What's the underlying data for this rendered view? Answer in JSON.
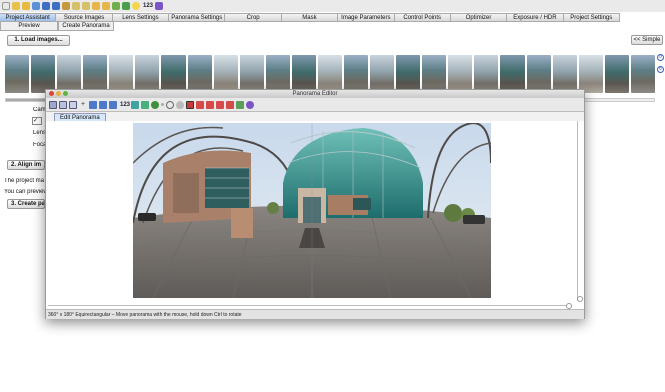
{
  "main": {
    "toolbar": {
      "num_label": "123"
    },
    "tabs": [
      {
        "label": "Project Assistant",
        "active": true
      },
      {
        "label": "Source Images"
      },
      {
        "label": "Lens Settings"
      },
      {
        "label": "Panorama Settings"
      },
      {
        "label": "Crop"
      },
      {
        "label": "Mask"
      },
      {
        "label": "Image Parameters"
      },
      {
        "label": "Control Points"
      },
      {
        "label": "Optimizer"
      },
      {
        "label": "Exposure / HDR"
      },
      {
        "label": "Project Settings"
      }
    ],
    "subtabs": [
      "Preview",
      "Create Panorama"
    ],
    "load_button": "1. Load images...",
    "simple_button": "<< Simple",
    "background_text": {
      "camera_label": "Cam",
      "lens_label": "Lens",
      "focal_label": "Foca",
      "align_button": "2. Align im",
      "project_text": "The project ma",
      "preview_text": "You can preview",
      "create_button": "3. Create pan"
    }
  },
  "editor": {
    "title": "Panorama Editor",
    "toolbar_num": "123",
    "tab": "Edit Panorama",
    "status": "360° x 180° Equirectangular – Move panorama with the mouse, hold down Ctrl to rotate"
  },
  "colors": {
    "active_tab": "#9ebfe9",
    "editor_tab": "#d6e6fb",
    "sky": "#cfe0ef",
    "glass": "#2f8a86"
  }
}
